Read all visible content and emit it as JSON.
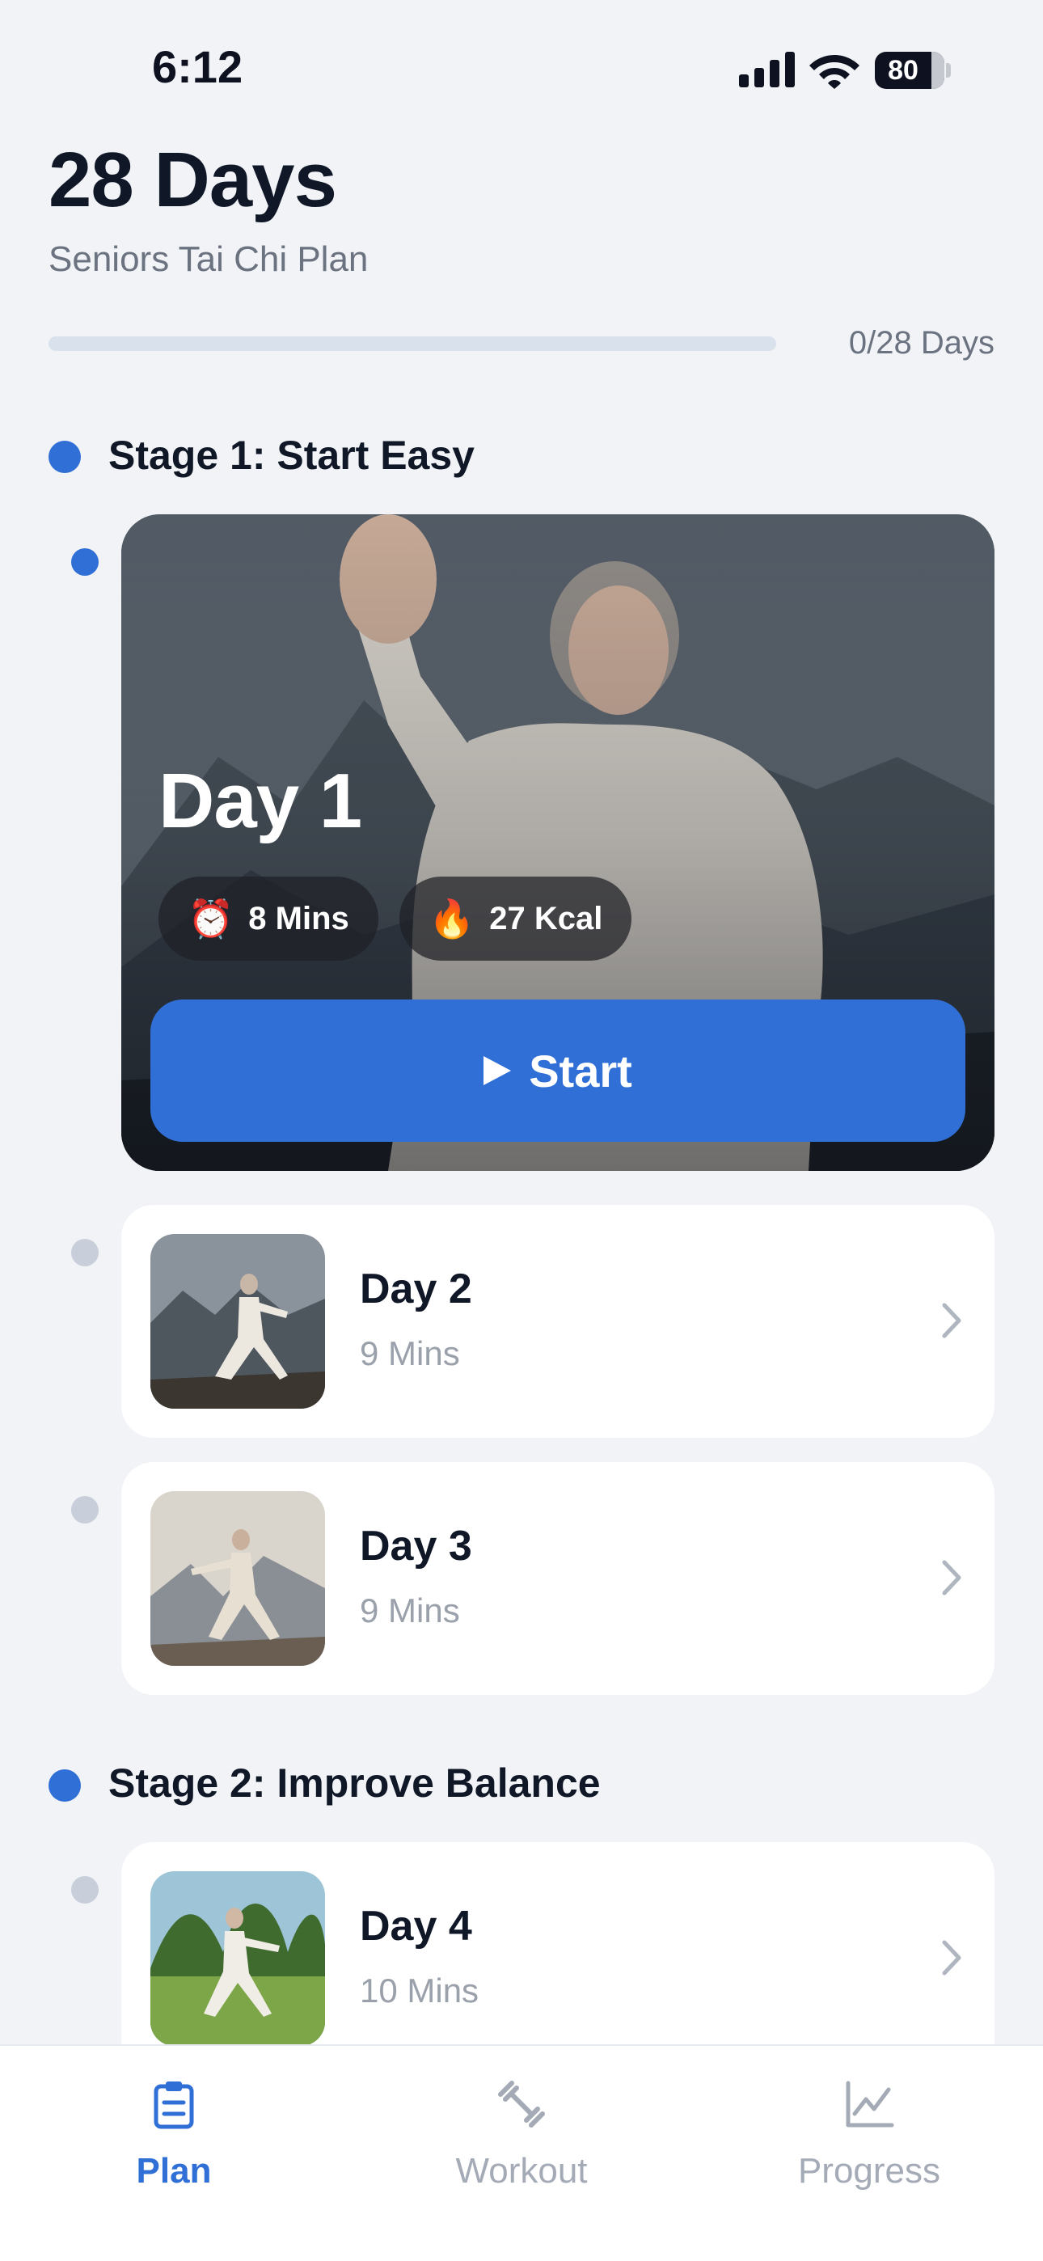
{
  "status_bar": {
    "time": "6:12",
    "battery": "80"
  },
  "header": {
    "title": "28 Days",
    "subtitle": "Seniors Tai Chi Plan",
    "progress_text": "0/28 Days",
    "progress_fraction": 0
  },
  "stages": [
    {
      "title": "Stage 1: Start Easy"
    },
    {
      "title": "Stage 2: Improve Balance"
    }
  ],
  "featured": {
    "day": "Day 1",
    "duration": "8 Mins",
    "duration_icon": "alarm-clock-icon",
    "calories": "27 Kcal",
    "calories_icon": "fire-icon",
    "start_label": "Start"
  },
  "days": [
    {
      "title": "Day 2",
      "duration": "9 Mins"
    },
    {
      "title": "Day 3",
      "duration": "9 Mins"
    },
    {
      "title": "Day 4",
      "duration": "10 Mins"
    }
  ],
  "tabs": [
    {
      "label": "Plan",
      "icon": "clipboard-icon",
      "active": true
    },
    {
      "label": "Workout",
      "icon": "dumbbell-icon",
      "active": false
    },
    {
      "label": "Progress",
      "icon": "chart-line-icon",
      "active": false
    }
  ],
  "colors": {
    "accent": "#2f6fd6",
    "background": "#f1f3f7",
    "inactive_dot": "#c8cfda"
  }
}
